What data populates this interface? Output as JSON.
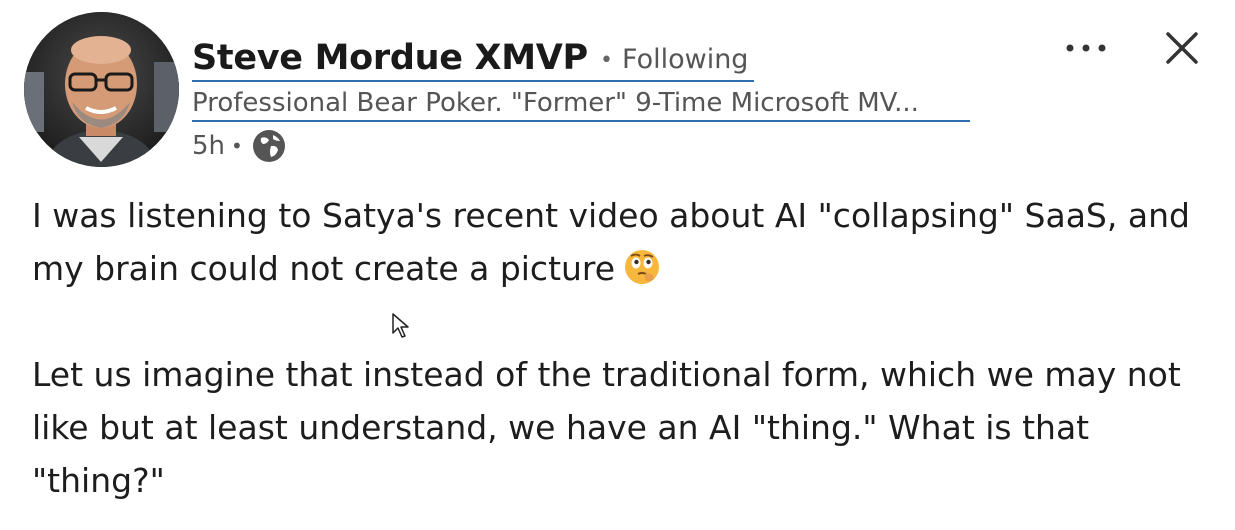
{
  "author": {
    "name": "Steve Mordue XMVP",
    "follow_status": "Following",
    "headline": "Professional Bear Poker. \"Former\" 9-Time Microsoft MV...",
    "time_ago": "5h",
    "visibility_icon": "globe-icon"
  },
  "actions": {
    "menu_icon": "more-options-icon",
    "close_icon": "close-icon"
  },
  "post": {
    "paragraph1": {
      "line1": "I was listening to Satya's recent video about AI \"collapsing\" SaaS, and",
      "line2": "my brain could not create a picture",
      "emoji": "thinking-face-emoji"
    },
    "paragraph2": {
      "line1": "Let us imagine that instead of the traditional form, which we may not",
      "line2": "like but at least understand, we have an AI \"thing.\" What is that",
      "line3": "\"thing?\""
    }
  },
  "colors": {
    "link_underline": "#2f6fb0",
    "text_primary": "#1d1d1d",
    "text_secondary": "#555555"
  }
}
